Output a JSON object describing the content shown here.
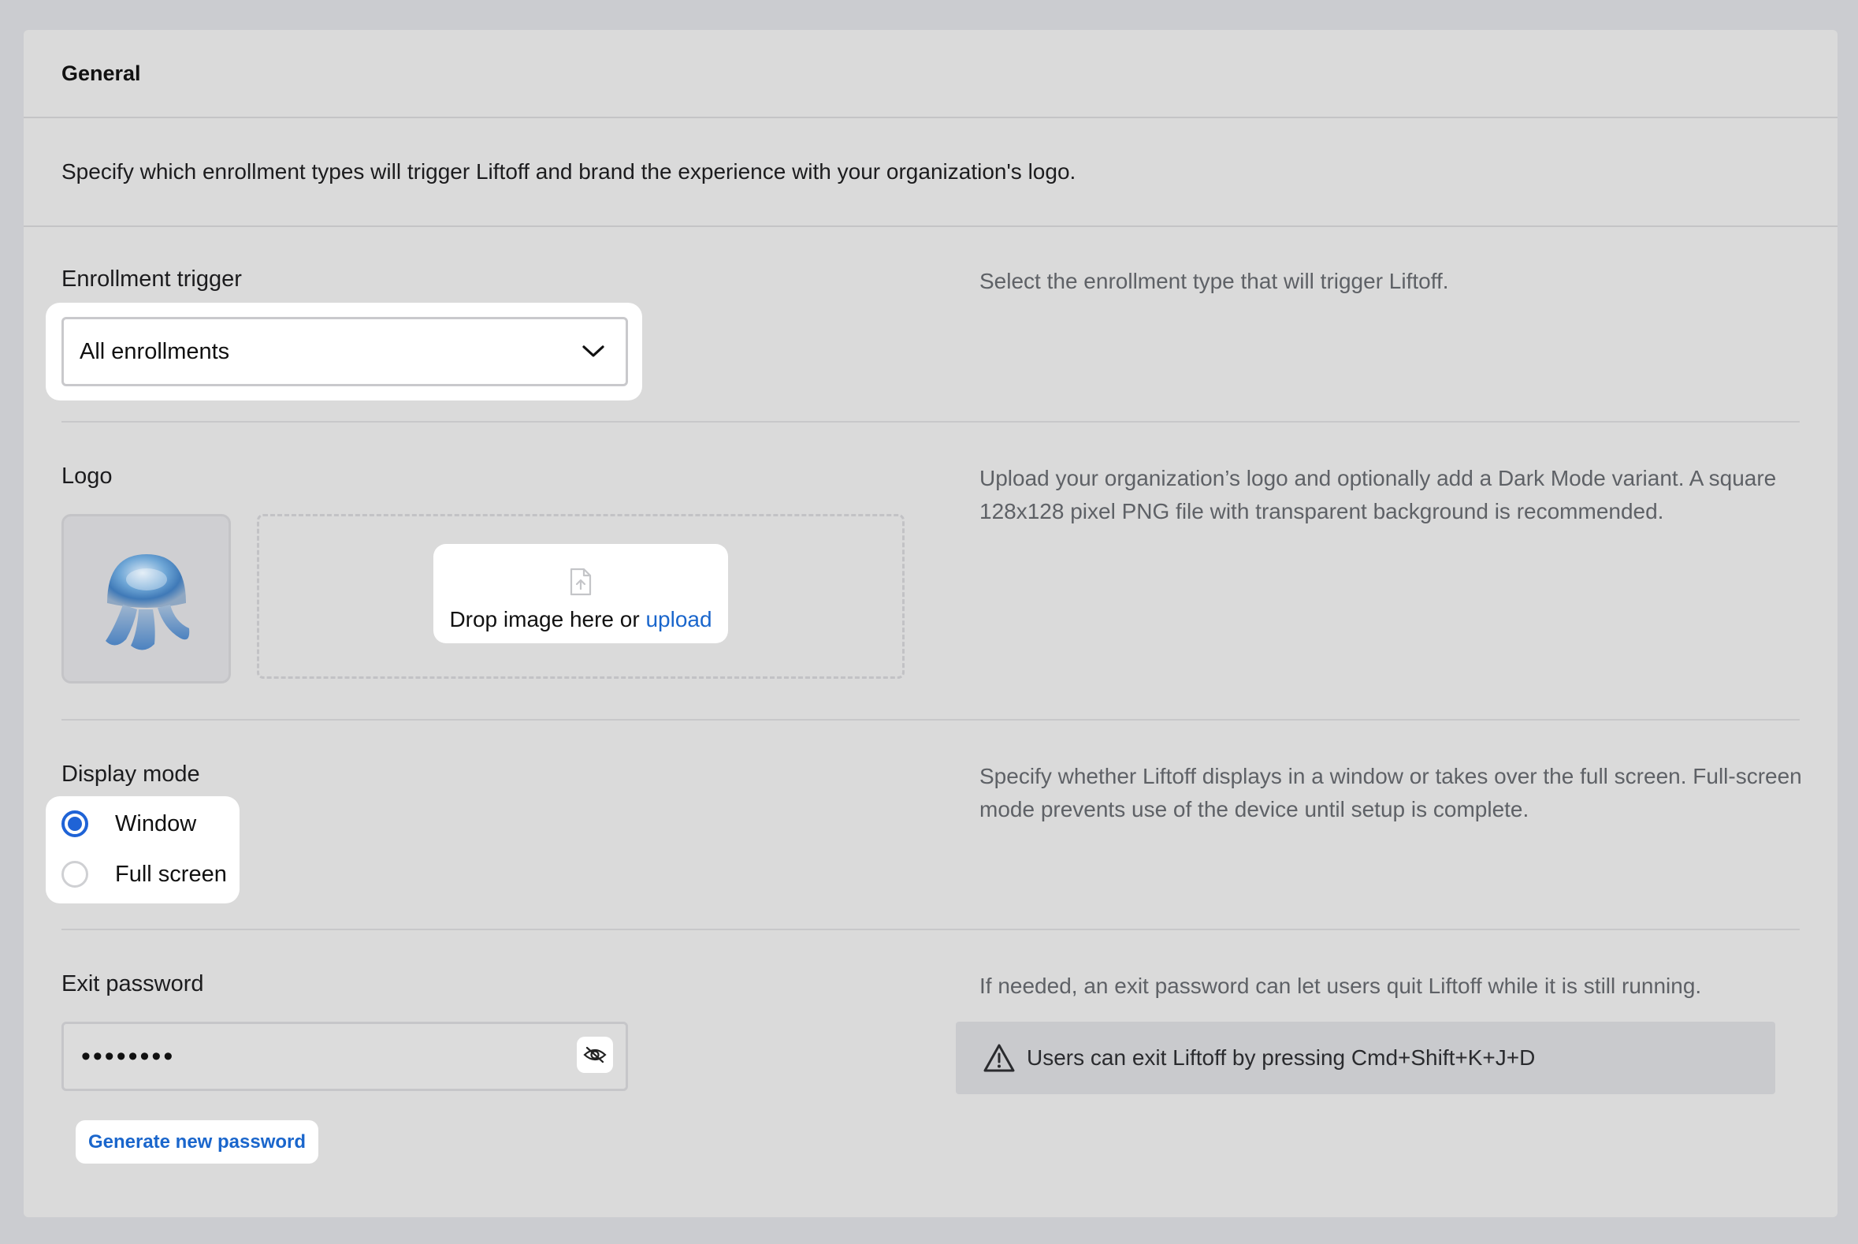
{
  "card": {
    "title": "General",
    "intro": "Specify which enrollment types will trigger Liftoff and brand the experience with your organization's logo."
  },
  "enrollment": {
    "label": "Enrollment trigger",
    "selected": "All enrollments",
    "help": "Select the enrollment type that will trigger Liftoff."
  },
  "logo": {
    "label": "Logo",
    "drop_text": "Drop image here or ",
    "upload_link": "upload",
    "help": "Upload your organization’s logo and optionally add a Dark Mode variant. A square 128x128 pixel PNG file with transparent background is recommended."
  },
  "display_mode": {
    "label": "Display mode",
    "options": [
      "Window",
      "Full screen"
    ],
    "selected": "Window",
    "help": "Specify whether Liftoff displays in a window or takes over the full screen. Full-screen mode prevents use of the device until setup is complete."
  },
  "exit_password": {
    "label": "Exit password",
    "value_masked": "••••••••",
    "help": "If needed, an exit password can let users quit Liftoff while it is still running.",
    "notice": "Users can exit Liftoff by pressing Cmd+Shift+K+J+D",
    "generate_label": "Generate new password"
  },
  "colors": {
    "accent": "#1f63d6",
    "link": "#1a66cc"
  }
}
